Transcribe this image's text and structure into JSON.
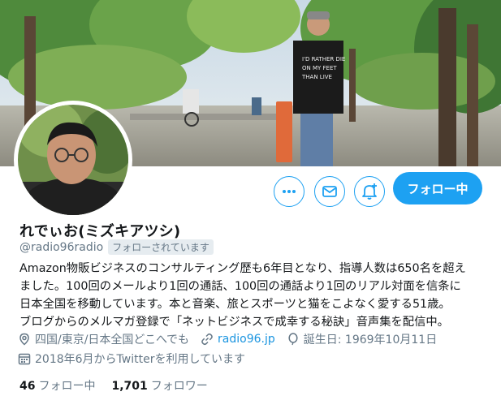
{
  "profile": {
    "display_name": "れでぃお(ミズキアツシ)",
    "handle": "@radio96radio",
    "follows_you_badge": "フォローされています",
    "bio_lines": [
      "Amazon物販ビジネスのコンサルティング歴も6年目となり、指導人数は650名を超え",
      "ました。100回のメールより1回の通話、100回の通話より1回のリアル対面を信条に",
      "日本全国を移動しています。本と音楽、旅とスポーツと猫をこよなく愛する51歳。",
      "ブログからのメルマガ登録で「ネットビジネスで成幸する秘訣」音声集を配信中。"
    ],
    "location": "四国/東京/日本全国どこへでも",
    "website": "radio96.jp",
    "birthday": "誕生日: 1969年10月11日",
    "joined": "2018年6月からTwitterを利用しています",
    "following_count": "46",
    "following_label": "フォロー中",
    "followers_count": "1,701",
    "followers_label": "フォロワー"
  },
  "actions": {
    "follow_button_label": "フォロー中"
  },
  "icons": {
    "more": "more-icon",
    "message": "mail-icon",
    "notify": "bell-plus-icon",
    "location": "location-pin-icon",
    "link": "link-icon",
    "birthday": "balloon-icon",
    "calendar": "calendar-icon"
  },
  "colors": {
    "accent": "#1da1f2",
    "link": "#1b95e0",
    "secondary_text": "#657786",
    "primary_text": "#14171a"
  }
}
